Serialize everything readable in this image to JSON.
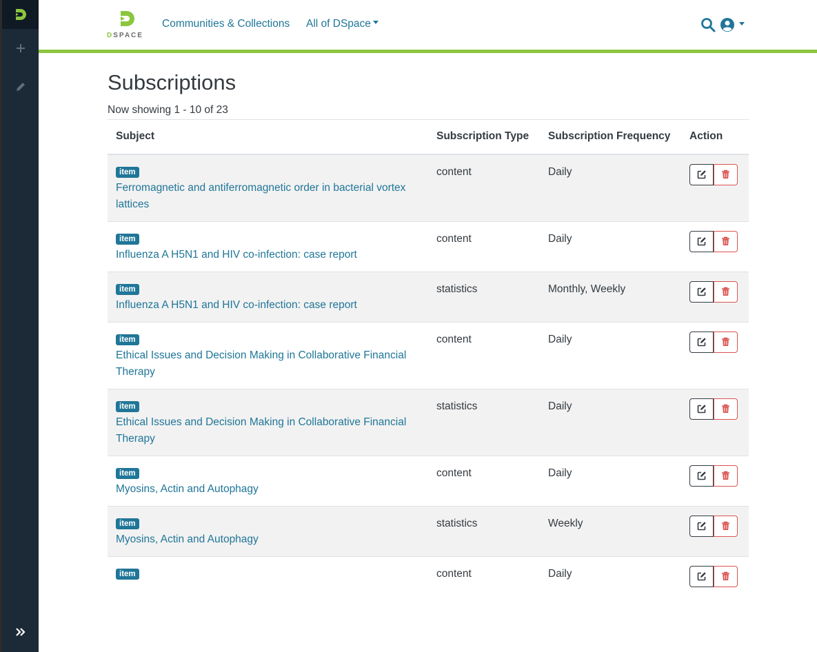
{
  "brand": {
    "logo_label": "DSPACE"
  },
  "nav": {
    "communities": "Communities & Collections",
    "all": "All of DSpace"
  },
  "icons": {
    "search": "search-icon",
    "user": "user-circle-icon",
    "add": "plus-icon",
    "edit": "pencil-icon",
    "expand": "double-chevron-right-icon",
    "row_edit": "edit-icon",
    "row_delete": "trash-icon"
  },
  "colors": {
    "accent": "#207698",
    "brand_green": "#8cc63f",
    "danger": "#d9534f",
    "sidebar": "#1c2a38"
  },
  "page": {
    "title": "Subscriptions",
    "showing": "Now showing 1 - 10 of 23"
  },
  "table": {
    "headers": [
      "Subject",
      "Subscription Type",
      "Subscription Frequency",
      "Action"
    ],
    "rows": [
      {
        "badge": "item",
        "title": "Ferromagnetic and antiferromagnetic order in bacterial vortex lattices",
        "type": "content",
        "frequency": "Daily"
      },
      {
        "badge": "item",
        "title": "Influenza A H5N1 and HIV co-infection: case report",
        "type": "content",
        "frequency": "Daily"
      },
      {
        "badge": "item",
        "title": "Influenza A H5N1 and HIV co-infection: case report",
        "type": "statistics",
        "frequency": "Monthly, Weekly"
      },
      {
        "badge": "item",
        "title": "Ethical Issues and Decision Making in Collaborative Financial Therapy",
        "type": "content",
        "frequency": "Daily"
      },
      {
        "badge": "item",
        "title": "Ethical Issues and Decision Making in Collaborative Financial Therapy",
        "type": "statistics",
        "frequency": "Daily"
      },
      {
        "badge": "item",
        "title": "Myosins, Actin and Autophagy",
        "type": "content",
        "frequency": "Daily"
      },
      {
        "badge": "item",
        "title": "Myosins, Actin and Autophagy",
        "type": "statistics",
        "frequency": "Weekly"
      },
      {
        "badge": "item",
        "title": "",
        "type": "content",
        "frequency": "Daily"
      }
    ]
  }
}
